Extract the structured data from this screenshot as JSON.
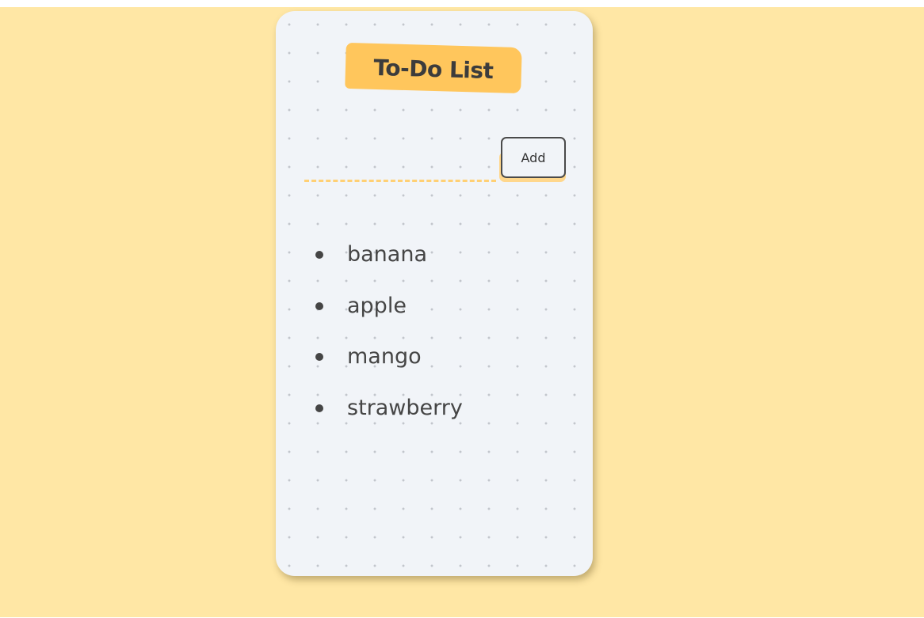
{
  "app": {
    "title": "To-Do List"
  },
  "input": {
    "value": "",
    "placeholder": ""
  },
  "add_button": {
    "label": "Add"
  },
  "todos": [
    "banana",
    "apple",
    "mango",
    "strawberry"
  ],
  "colors": {
    "page_background": "#ffe7a5",
    "card_background": "#f1f4f8",
    "title_highlight": "#ffc65c",
    "input_underline": "#ffd074",
    "text": "#454545"
  }
}
